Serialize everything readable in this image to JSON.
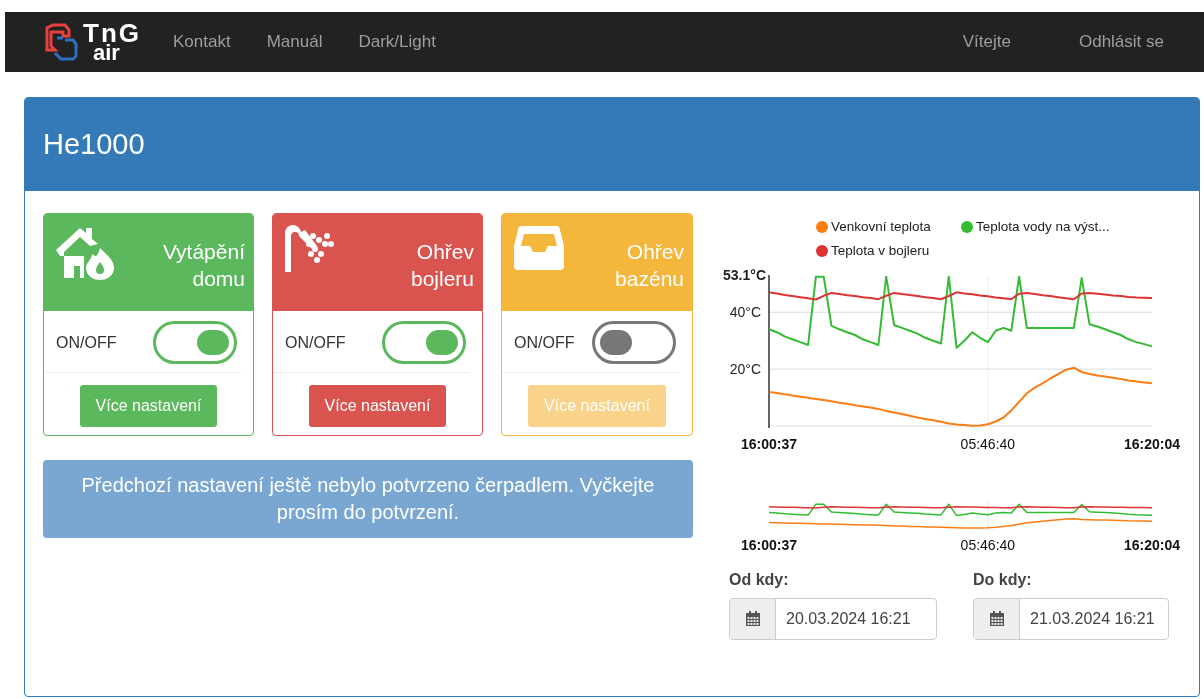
{
  "navbar": {
    "logo": {
      "line1": "TnG",
      "line2": "air"
    },
    "links": [
      "Kontakt",
      "Manuál",
      "Dark/Light"
    ],
    "right_links": [
      "Vítejte",
      "Odhlásit se"
    ]
  },
  "panel": {
    "title": "He1000"
  },
  "tiles": [
    {
      "kind": "heating",
      "title": "Vytápění domu",
      "color": "#5cb85c",
      "switch_label": "ON/OFF",
      "on": true,
      "button": "Více nastavení",
      "disabled": false
    },
    {
      "kind": "boiler",
      "title": "Ohřev bojleru",
      "color": "#d9534f",
      "switch_label": "ON/OFF",
      "on": true,
      "button": "Více nastavení",
      "disabled": false
    },
    {
      "kind": "pool",
      "title": "Ohřev bazénu",
      "color": "#f4b63b",
      "switch_label": "ON/OFF",
      "on": false,
      "button": "Více nastavení",
      "disabled": true
    }
  ],
  "notice": "Předchozí nastavení ještě nebylo potvrzeno čerpadlem. Vyčkejte prosím do potvrzení.",
  "chart": {
    "chart_data": {
      "type": "line",
      "categories": [
        "16:00:37",
        null,
        null,
        null,
        null,
        null,
        null,
        null,
        null,
        null,
        null,
        null,
        null,
        null,
        null,
        null,
        null,
        null,
        null,
        null,
        null,
        null,
        null,
        null,
        null,
        null,
        null,
        null,
        "05:46:40",
        null,
        null,
        null,
        null,
        null,
        null,
        null,
        null,
        null,
        null,
        null,
        null,
        null,
        null,
        null,
        null,
        null,
        null,
        null,
        null,
        "16:20:04"
      ],
      "series": [
        {
          "name": "Venkovní teplota",
          "color": "#fb7d16",
          "values": [
            12,
            11.6,
            11.2,
            10.7,
            10.3,
            9.9,
            9.5,
            9.1,
            8.7,
            8.2,
            7.8,
            7.3,
            6.9,
            6.5,
            6,
            5.3,
            4.7,
            4.2,
            3.6,
            3,
            2.5,
            2,
            1.5,
            0.9,
            0.5,
            0.3,
            0.1,
            0.2,
            0.6,
            1.6,
            3,
            5.5,
            8.5,
            11.5,
            13.5,
            15,
            16.7,
            18.2,
            19.8,
            20.5,
            19,
            18.3,
            17.8,
            17.4,
            17,
            16.5,
            16,
            15.6,
            15.3,
            15
          ]
        },
        {
          "name": "Teplota vody na výst...",
          "color": "#33bb33",
          "values": [
            34,
            33,
            31.5,
            30.5,
            29.5,
            28.5,
            52.5,
            52.5,
            35.2,
            34,
            33,
            32,
            30.5,
            29.5,
            28.5,
            52.5,
            35.5,
            34.5,
            33.5,
            32.5,
            31,
            30,
            29,
            52.5,
            27.5,
            30,
            33,
            31,
            29.5,
            33.5,
            34.5,
            33.5,
            52.5,
            34.5,
            34.5,
            34.5,
            34.5,
            34.5,
            34.5,
            34.5,
            52,
            35.8,
            35,
            34,
            33,
            32,
            30.5,
            29.5,
            28.8,
            28
          ]
        },
        {
          "name": "Teplota v bojleru",
          "color": "#dd3333",
          "values": [
            47,
            46.6,
            46.1,
            45.7,
            45.3,
            44.9,
            44.5,
            45.8,
            46.8,
            46.4,
            46,
            45.7,
            45.3,
            45,
            44.6,
            45.8,
            46.8,
            46.4,
            46.1,
            45.7,
            45.3,
            45,
            44.6,
            45.7,
            47,
            46.6,
            46.3,
            45.9,
            45.6,
            45.2,
            44.9,
            44.6,
            46.5,
            46.8,
            46.4,
            46,
            45.7,
            45.3,
            44.9,
            44.6,
            46.6,
            46.8,
            46.5,
            46.2,
            45.9,
            45.7,
            45.4,
            45.2,
            45.1,
            45
          ]
        }
      ],
      "legend": "top",
      "ylim": [
        0,
        53.1
      ],
      "yticks": [
        {
          "value": 20,
          "label": "20°C"
        },
        {
          "value": 40,
          "label": "40°C"
        },
        {
          "value": 53.1,
          "label": "53.1°C"
        }
      ]
    }
  },
  "navigator": {
    "labels": [
      "16:00:37",
      "05:46:40",
      "16:20:04"
    ]
  },
  "range": [
    {
      "label": "Od kdy:",
      "value": "20.03.2024 16:21"
    },
    {
      "label": "Do kdy:",
      "value": "21.03.2024 16:21"
    }
  ]
}
